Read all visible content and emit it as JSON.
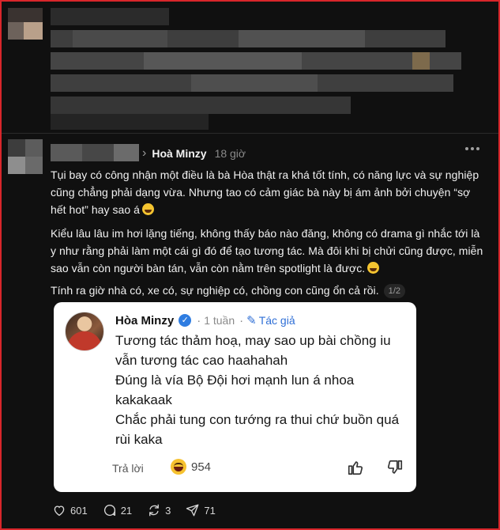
{
  "comment": {
    "author": "Hoà Minzy",
    "time": "18 giờ",
    "paragraphs": [
      "Tụi bay có công nhận một điều là bà Hòa thật ra khá tốt tính, có năng lực và sự nghiệp cũng chẳng phải dạng vừa. Nhưng tao có cảm giác bà này bị ám ảnh bởi chuyện “sợ hết hot” hay sao á",
      "Kiểu lâu lâu im hơi lặng tiếng, không thấy báo nào đăng, không có drama gì nhắc tới là y như rằng phải làm một cái gì đó để tạo tương tác. Mà đôi khi bị chửi cũng được, miễn sao vẫn còn người bàn tán, vẫn còn nằm trên spotlight là được.",
      "Tính ra giờ nhà có, xe có, sự nghiệp có, chồng con cũng ổn cả rồi."
    ],
    "page_indicator": "1/2"
  },
  "reply_card": {
    "author": "Hòa Minzy",
    "dot": "·",
    "time": "1 tuần",
    "dot2": "·",
    "author_tag": "Tác giả",
    "body": [
      "Tương tác thảm hoạ, may sao up bài chồng iu vẫn tương tác cao haahahah",
      "Đúng là vía Bộ Đội hơi mạnh lun á nhoa kakakaak",
      "Chắc phải tung con tướng ra thui chứ buồn quá rùi kaka"
    ],
    "reply_label": "Trả lời",
    "reaction_count": "954"
  },
  "stats": {
    "likes": "601",
    "comments": "21",
    "reposts": "3",
    "shares": "71"
  },
  "icons": [
    "more-icon",
    "verified-icon",
    "pencil-icon",
    "laugh-emoji-icon",
    "thumb-up-icon",
    "thumb-down-icon",
    "heart-icon",
    "comment-icon",
    "repost-icon",
    "share-icon"
  ],
  "colors": {
    "background": "#101010",
    "accent_link": "#2f6fd6",
    "verified": "#2f7de1",
    "frame_border": "#d8262b"
  }
}
